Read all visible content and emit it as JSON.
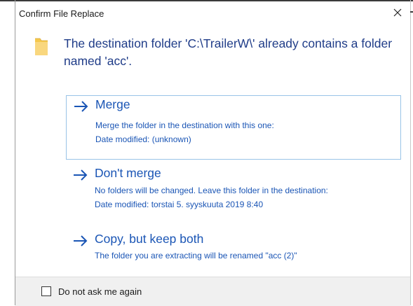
{
  "dialog": {
    "title": "Confirm File Replace",
    "close_glyph": "×",
    "message": "The destination folder 'C:\\TrailerW\\' already contains a folder named 'acc'.",
    "icon": "folder-icon"
  },
  "options": [
    {
      "title": "Merge",
      "line1": "Merge the folder in the destination with this one:",
      "line2": "Date modified: (unknown)",
      "selected": true
    },
    {
      "title": "Don't merge",
      "line1": "No folders will be changed. Leave this folder in the destination:",
      "line2": "Date modified: torstai 5. syyskuuta 2019  8:40",
      "selected": false
    },
    {
      "title": "Copy, but keep both",
      "line1": "The folder you are extracting will be renamed \"acc (2)\"",
      "selected": false
    }
  ],
  "footer": {
    "checkbox_label": "Do not ask me again",
    "checked": false
  },
  "colors": {
    "message": "#1f3c88",
    "option_text": "#1a55b5",
    "selected_border": "#99c3e7",
    "folder": "#f5c84c"
  }
}
